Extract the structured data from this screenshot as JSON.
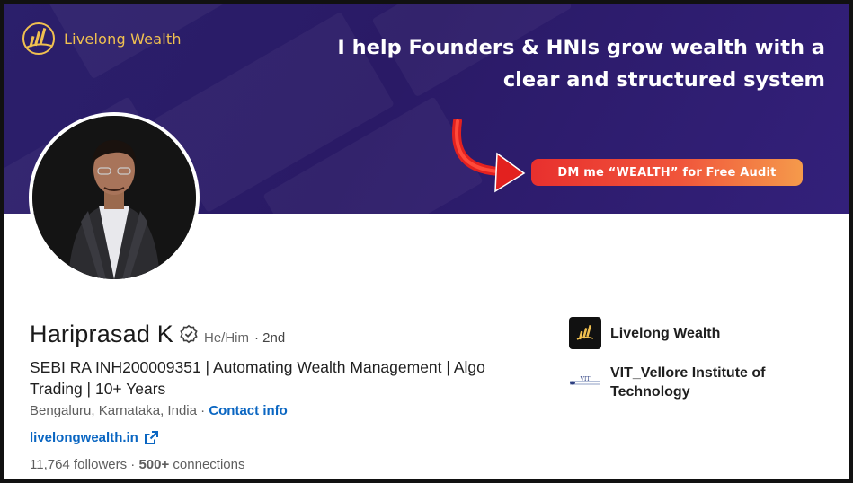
{
  "banner": {
    "brand_name": "Livelong Wealth",
    "headline": "I help Founders & HNIs grow wealth with a clear and structured system",
    "cta": "DM me “WEALTH” for Free Audit",
    "colors": {
      "background": "#2b1f6b",
      "brand_gold": "#f0c050",
      "cta_start": "#e8302e",
      "cta_end": "#f59a4b",
      "arrow": "#e3211f"
    }
  },
  "profile": {
    "name": "Hariprasad K",
    "pronouns": "He/Him",
    "degree": "· 2nd",
    "headline": "SEBI RA INH200009351 | Automating Wealth Management | Algo Trading | 10+ Years",
    "location": "Bengaluru, Karnataka, India",
    "location_sep": " · ",
    "contact_label": "Contact info",
    "website": "livelongwealth.in",
    "followers_count": "11,764 followers",
    "followers_sep": " · ",
    "connections_count": "500+",
    "connections_label": " connections"
  },
  "organizations": [
    {
      "name": "Livelong Wealth",
      "icon": "livelong-wealth-logo"
    },
    {
      "name": "VIT_Vellore Institute of Technology",
      "icon": "vit-logo"
    }
  ],
  "colors": {
    "link": "#0a66c2",
    "text": "#1f1f1f",
    "muted": "#5e5e5e"
  }
}
